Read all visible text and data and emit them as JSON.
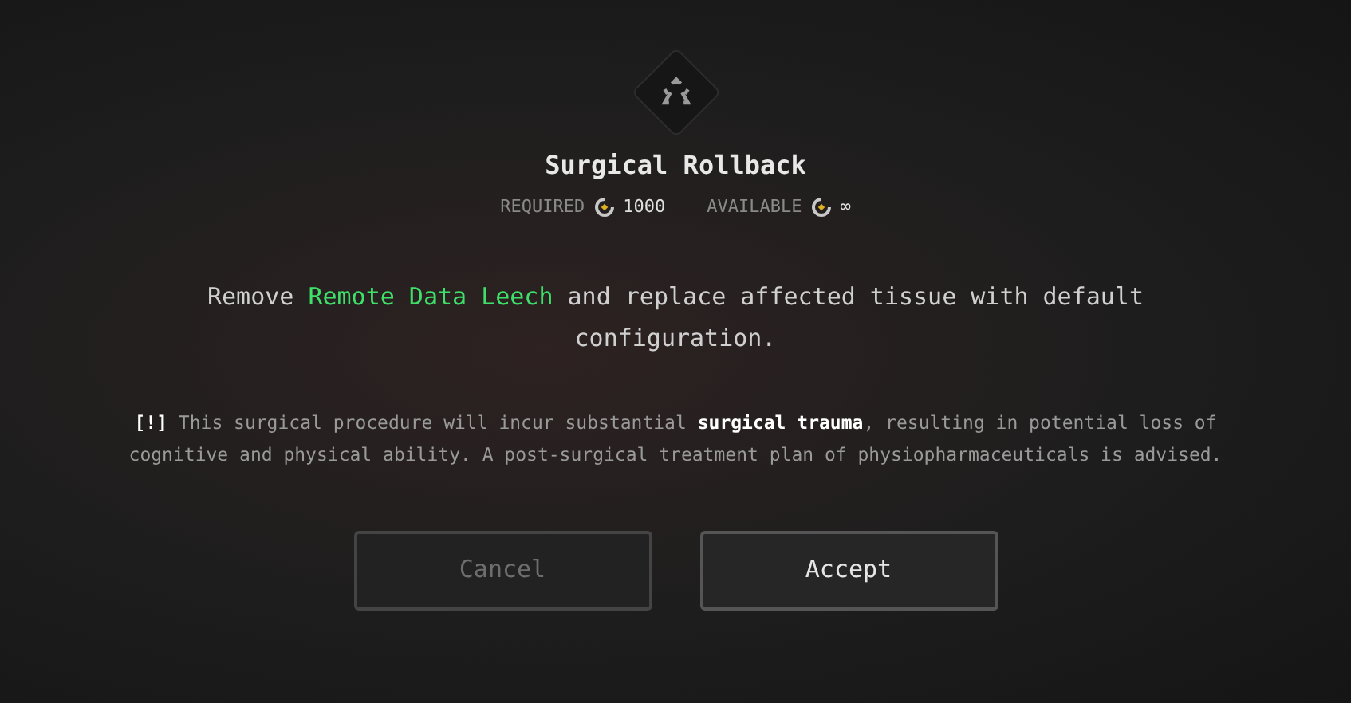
{
  "dialog": {
    "title": "Surgical Rollback",
    "cost": [
      {
        "label": "REQUIRED",
        "value": "1000"
      },
      {
        "label": "AVAILABLE",
        "value": "∞"
      }
    ],
    "description": {
      "before": "Remove ",
      "highlight": "Remote Data Leech",
      "after": " and replace affected tissue with default configuration."
    },
    "warning": "**[!]** This surgical procedure will incur substantial **surgical trauma**, resulting in potential loss of cognitive and physical ability. A post-surgical treatment plan of physiopharmaceuticals is advised.",
    "buttons": [
      {
        "label": "Cancel",
        "disabled": true
      },
      {
        "label": "Accept",
        "disabled": false
      }
    ]
  }
}
